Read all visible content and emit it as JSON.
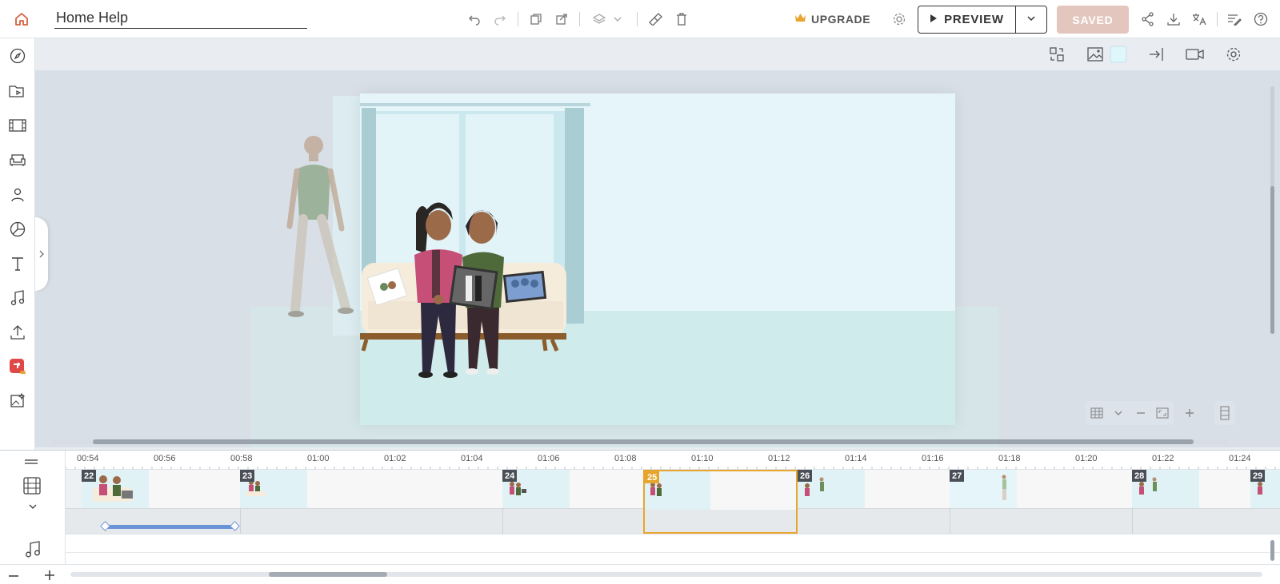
{
  "header": {
    "project_title": "Home Help",
    "upgrade_label": "UPGRADE",
    "preview_label": "PREVIEW",
    "saved_label": "SAVED"
  },
  "colors": {
    "accent": "#e7a52e",
    "saved_bg": "#e3c6bd",
    "selection": "#e7a52e",
    "animation_bar": "#6b93d8"
  },
  "sidebar": {
    "items": [
      {
        "icon": "compass-icon"
      },
      {
        "icon": "folder-video-icon"
      },
      {
        "icon": "film-strip-icon"
      },
      {
        "icon": "armchair-icon"
      },
      {
        "icon": "person-icon"
      },
      {
        "icon": "pie-chart-icon"
      },
      {
        "icon": "text-icon"
      },
      {
        "icon": "music-icon"
      },
      {
        "icon": "upload-icon"
      },
      {
        "icon": "premium-app-icon"
      },
      {
        "icon": "magic-image-icon"
      }
    ]
  },
  "timeline": {
    "ruler": [
      "00:54",
      "00:56",
      "00:58",
      "01:00",
      "01:02",
      "01:04",
      "01:06",
      "01:08",
      "01:10",
      "01:12",
      "01:14",
      "01:16",
      "01:18",
      "01:20",
      "01:22",
      "01:24"
    ],
    "scenes": [
      {
        "number": "22"
      },
      {
        "number": "23"
      },
      {
        "number": "24"
      },
      {
        "number": "25",
        "selected": true
      },
      {
        "number": "26"
      },
      {
        "number": "27"
      },
      {
        "number": "28"
      },
      {
        "number": "29"
      }
    ]
  }
}
